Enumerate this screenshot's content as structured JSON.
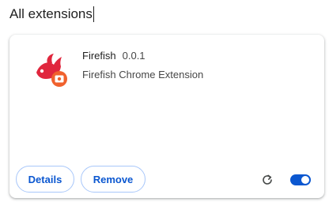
{
  "section": {
    "title": "All extensions"
  },
  "extension": {
    "name": "Firefish",
    "version": "0.0.1",
    "description": "Firefish Chrome Extension",
    "icon": "firefish-logo-icon",
    "enabled": true
  },
  "actions": {
    "details_label": "Details",
    "remove_label": "Remove",
    "reload_icon": "reload-icon",
    "toggle_state": "on"
  },
  "colors": {
    "accent": "#0b57d0",
    "button_border": "#a8c7fa",
    "logo_red": "#e0263d",
    "logo_orange": "#f0612d"
  }
}
